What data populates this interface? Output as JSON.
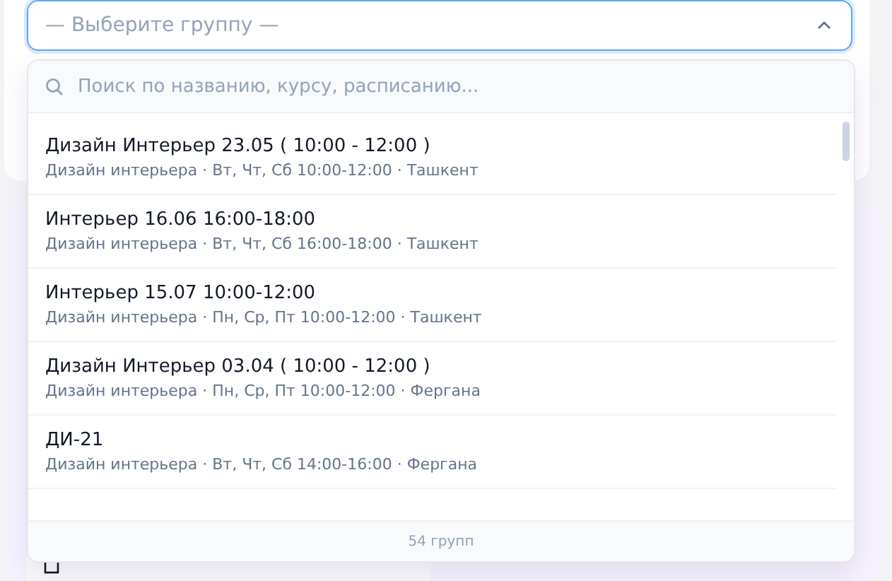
{
  "group_select": {
    "placeholder": "— Выберите группу —",
    "expanded": true
  },
  "dropdown": {
    "search": {
      "placeholder": "Поиск по названию, курсу, расписанию..."
    },
    "options": [
      {
        "name": "Дизайн Интерьер 23.05 ( 10:00 - 12:00 )",
        "details": "Дизайн интерьера · Вт, Чт, Сб 10:00-12:00 · Ташкент"
      },
      {
        "name": "Интерьер 16.06 16:00-18:00",
        "details": "Дизайн интерьера · Вт, Чт, Сб 16:00-18:00 · Ташкент"
      },
      {
        "name": "Интерьер 15.07 10:00-12:00",
        "details": "Дизайн интерьера · Пн, Ср, Пт 10:00-12:00 · Ташкент"
      },
      {
        "name": "Дизайн Интерьер 03.04 ( 10:00 - 12:00 )",
        "details": "Дизайн интерьера · Пн, Ср, Пт 10:00-12:00 · Фергана"
      },
      {
        "name": "ДИ-21",
        "details": "Дизайн интерьера · Вт, Чт, Сб 14:00-16:00 · Фергана"
      }
    ],
    "count": "54 групп"
  }
}
